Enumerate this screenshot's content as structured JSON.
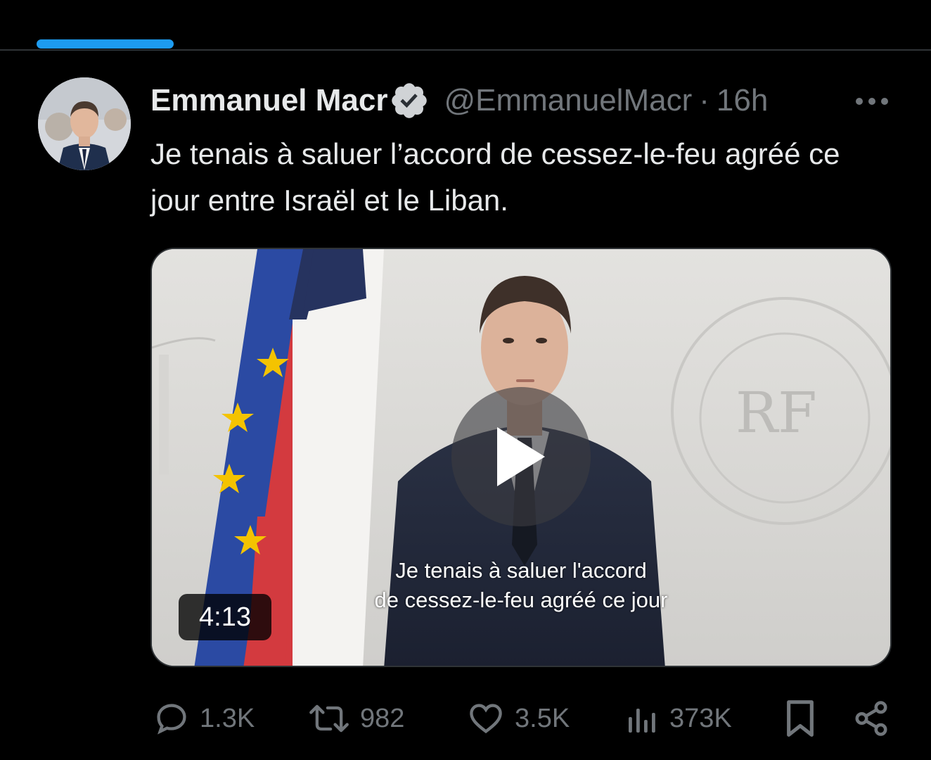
{
  "tweet": {
    "author": {
      "display_name": "Emmanuel Macr",
      "handle": "@EmmanuelMacr",
      "verified": true
    },
    "separator": "·",
    "time": "16h",
    "text": "Je tenais à saluer l’accord de cessez-le-feu agréé ce jour entre Israël et le Liban.",
    "media": {
      "type": "video",
      "duration": "4:13",
      "subtitle_line1": "Je tenais à saluer l'accord",
      "subtitle_line2": "de cessez-le-feu agréé ce jour"
    },
    "actions": {
      "replies": "1.3K",
      "reposts": "982",
      "likes": "3.5K",
      "views": "373K"
    }
  },
  "colors": {
    "background": "#000000",
    "text_primary": "#e7e9ea",
    "text_secondary": "#71767b",
    "accent": "#1d9bf0",
    "divider": "#2f3336"
  },
  "icons": {
    "verified": "verified-badge-icon",
    "more": "more-horizontal-icon",
    "reply": "reply-icon",
    "repost": "repost-icon",
    "like": "like-icon",
    "views": "views-icon",
    "bookmark": "bookmark-icon",
    "share": "share-icon",
    "play": "play-icon"
  }
}
